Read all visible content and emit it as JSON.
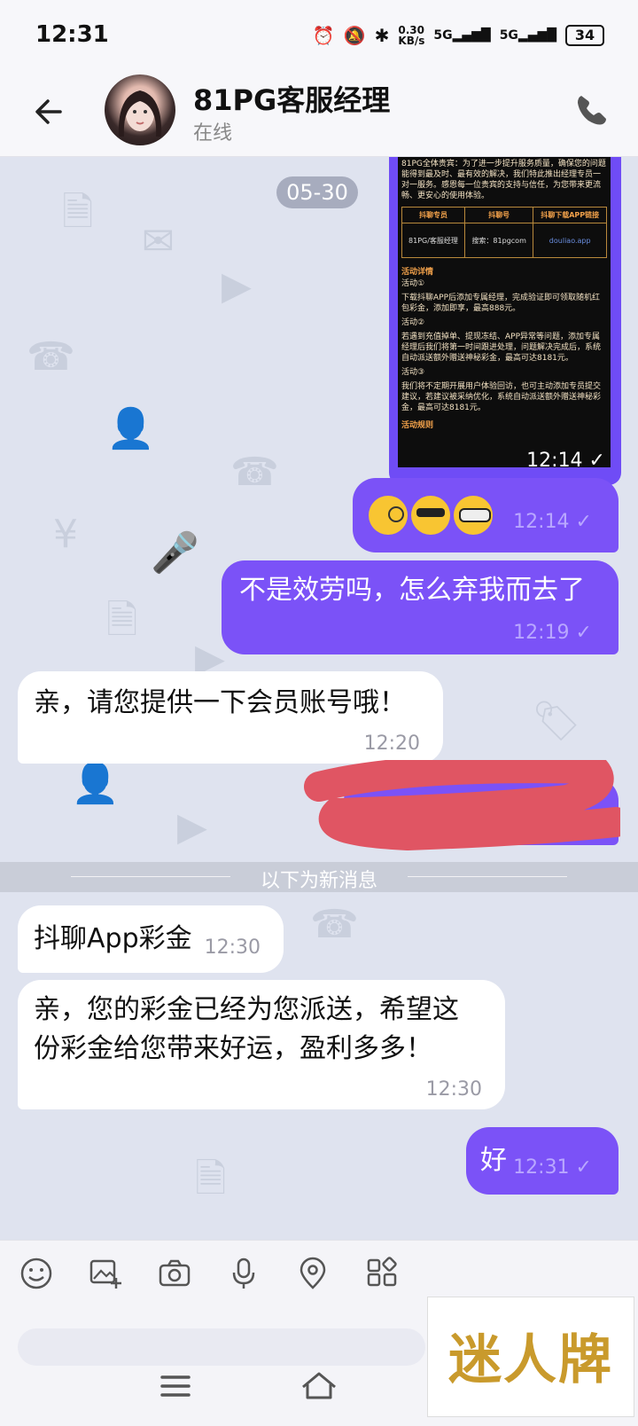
{
  "status_bar": {
    "time": "12:31",
    "net_speed_value": "0.30",
    "net_speed_unit": "KB/s",
    "signal1": "5G",
    "signal2": "5G",
    "battery": "34"
  },
  "header": {
    "name": "81PG客服经理",
    "status": "在线"
  },
  "chat": {
    "date_chip": "05-30",
    "image_message": {
      "intro": "81PG全体贵宾：为了进一步提升服务质量，确保您的问题能得到最及时、最有效的解决，我们特此推出经理专员一对一服务。感恩每一位贵宾的支持与信任，为您带来更流畅、更安心的使用体验。",
      "table_headers": [
        "抖聊专员",
        "抖聊号",
        "抖聊下载APP链接"
      ],
      "table_row": [
        "81PG/客服经理",
        "搜索：81pgcom",
        "douliao.app"
      ],
      "section_title": "活动详情",
      "act1_title": "活动①",
      "act1_text": "下载抖聊APP后添加专属经理，完成验证即可领取随机红包彩金，添加即享，最高888元。",
      "act2_title": "活动②",
      "act2_text": "若遇到充值掉单、提现冻结、APP异常等问题，添加专属经理后我们将第一时间跟进处理，问题解决完成后，系统自动派送额外赠送神秘彩金，最高可达8181元。",
      "act3_title": "活动③",
      "act3_text": "我们将不定期开展用户体验回访，也可主动添加专员提交建议，若建议被采纳优化，系统自动派送额外赠送神秘彩金，最高可达8181元。",
      "rules_title": "活动规则",
      "time": "12:14"
    },
    "emoji_message": {
      "time": "12:14",
      "emojis": [
        "face-with-monocle",
        "smiling-face-with-sunglasses",
        "disguised-face"
      ]
    },
    "out_message_1": {
      "text": "不是效劳吗，怎么弃我而去了",
      "time": "12:19"
    },
    "in_message_1": {
      "text": "亲，请您提供一下会员账号哦！",
      "time": "12:20"
    },
    "new_messages_label": "以下为新消息",
    "in_message_2": {
      "text": "抖聊App彩金",
      "time": "12:30"
    },
    "in_message_3": {
      "line1": "亲，您的彩金已经为您派送，希望这",
      "line2": "份彩金给您带来好运，盈利多多！",
      "time": "12:30"
    },
    "out_message_2": {
      "text": "好",
      "time": "12:31"
    }
  },
  "toolbar": {
    "icons": [
      "emoji-icon",
      "image-add-icon",
      "camera-icon",
      "microphone-icon",
      "location-icon",
      "apps-icon"
    ]
  },
  "watermark": {
    "text": "迷人牌"
  },
  "colors": {
    "accent": "#7b52f7",
    "chat_bg": "#dfe3ef",
    "incoming_bubble": "#ffffff"
  }
}
